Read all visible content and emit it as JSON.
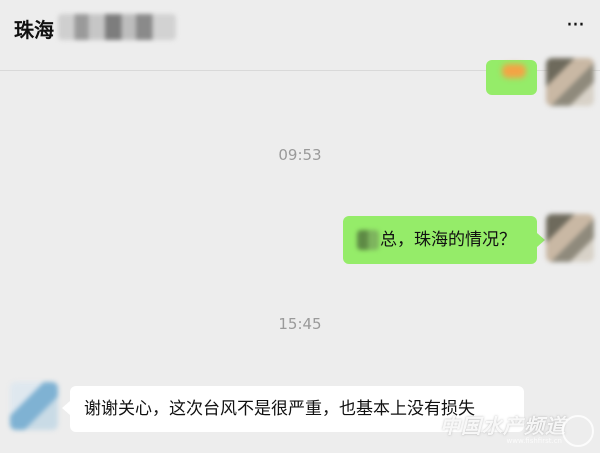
{
  "header": {
    "title": "珠海",
    "more_label": "···"
  },
  "messages": [
    {
      "side": "right",
      "type": "sticker"
    },
    {
      "type": "timestamp",
      "text": "09:53"
    },
    {
      "side": "right",
      "type": "text",
      "text": "总，珠海的情况？"
    },
    {
      "type": "timestamp",
      "text": "15:45"
    },
    {
      "side": "left",
      "type": "text",
      "text": "谢谢关心，这次台风不是很严重，也基本上没有损失"
    }
  ],
  "watermark": {
    "text": "中国水产频道",
    "sub": "www.fishfirst.cn"
  },
  "colors": {
    "background": "#ededed",
    "sent_bubble": "#95ec69",
    "received_bubble": "#ffffff",
    "timestamp": "#9a9a9a"
  },
  "icons": {
    "more": "more-dots-icon",
    "watermark_logo": "globe-icon"
  }
}
